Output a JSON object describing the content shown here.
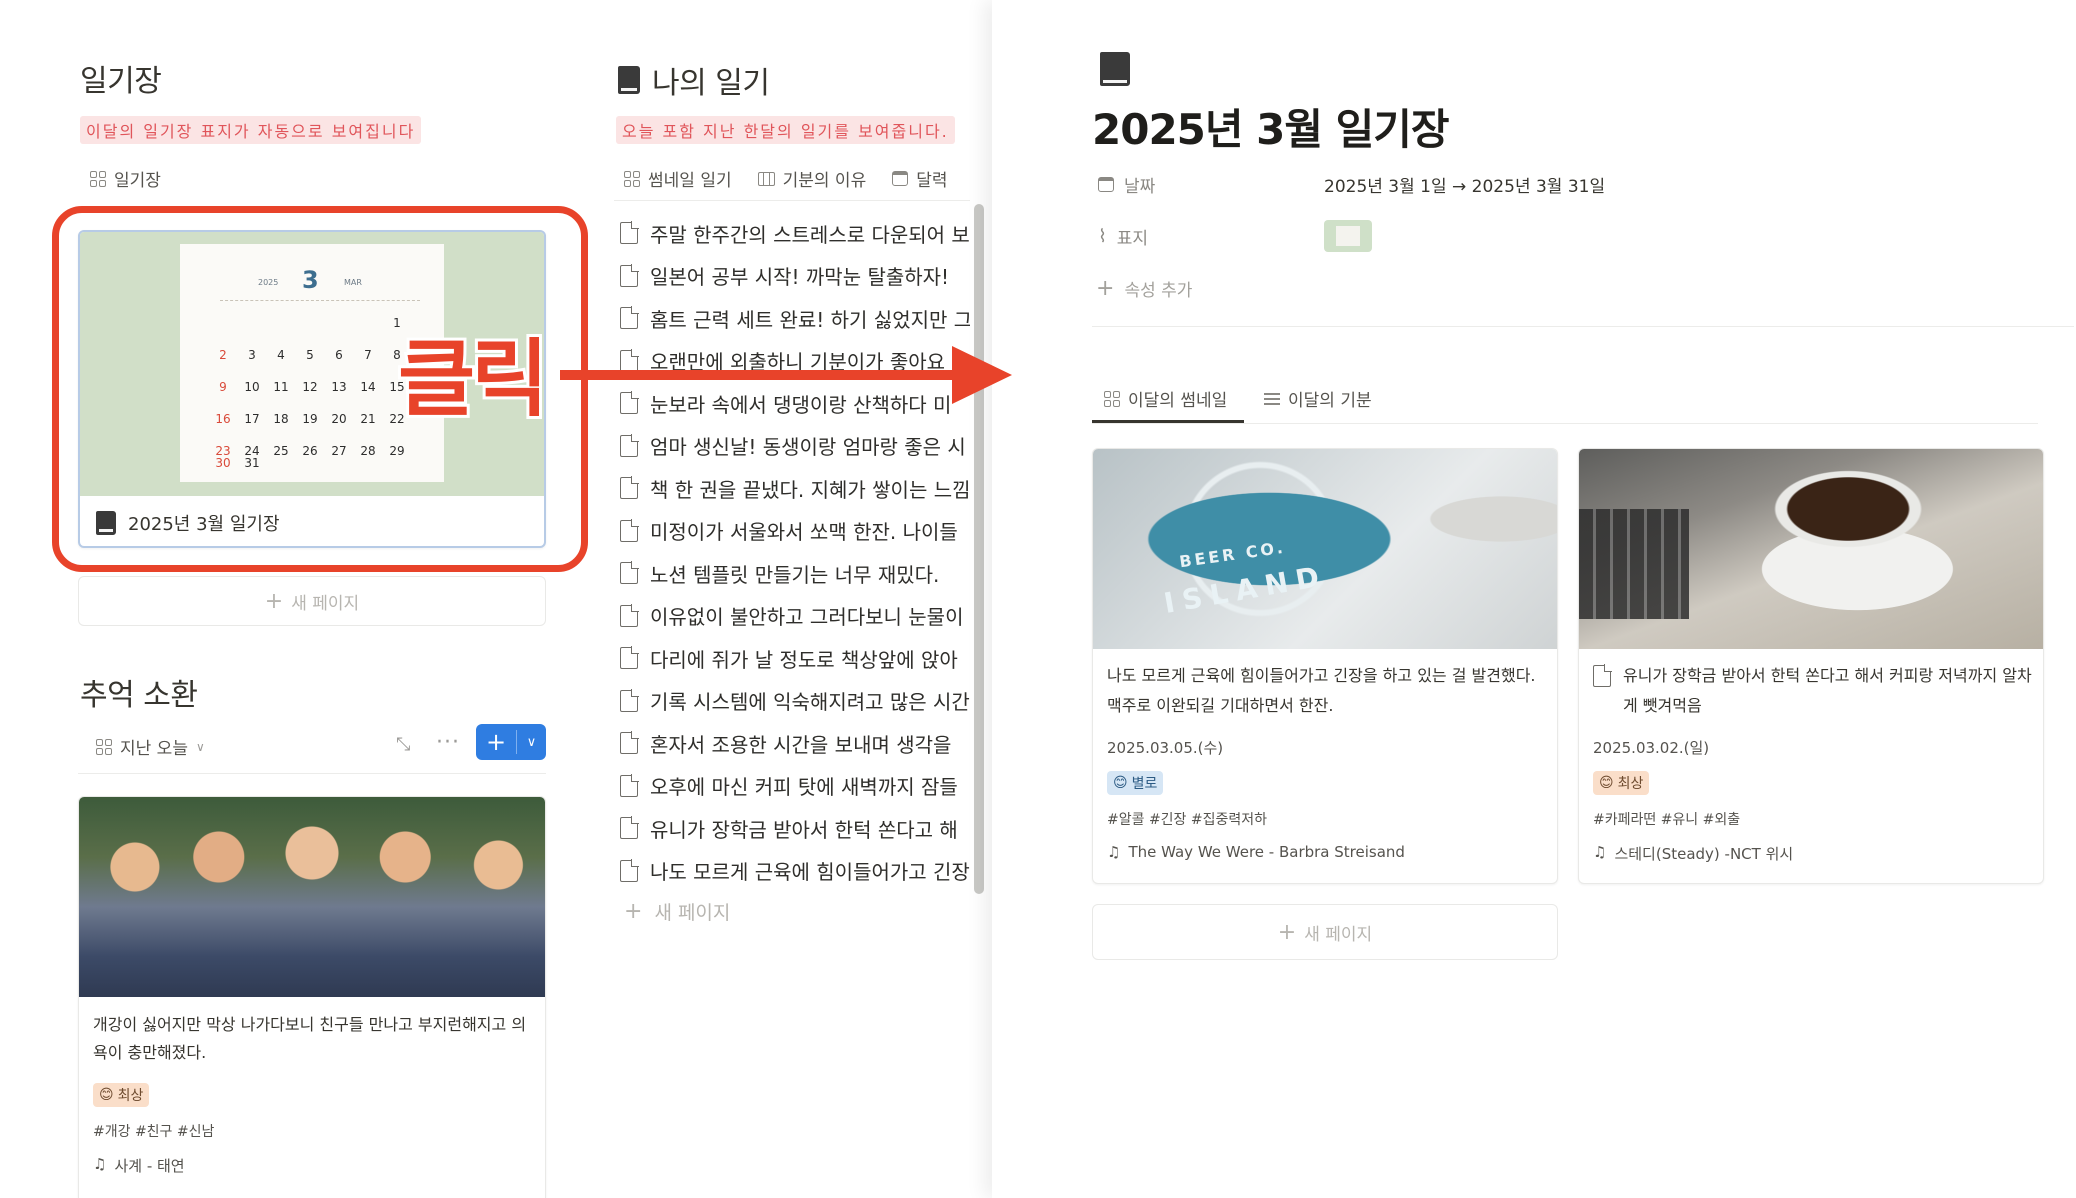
{
  "left": {
    "diary_title": "일기장",
    "diary_hint": "이달의 일기장 표지가 자동으로 보여집니다",
    "diary_view": "일기장",
    "calendar_card": {
      "year": "2025",
      "month": "3",
      "month_abbr": "MAR",
      "days": [
        "1",
        "2",
        "3",
        "4",
        "5",
        "6",
        "7",
        "8",
        "9",
        "10",
        "11",
        "12",
        "13",
        "14",
        "15",
        "16",
        "17",
        "18",
        "19",
        "20",
        "21",
        "22",
        "23",
        "24",
        "25",
        "26",
        "27",
        "28",
        "29",
        "30",
        "31"
      ],
      "caption": "2025년 3월 일기장"
    },
    "new_page": "새 페이지",
    "memory_title": "추억 소환",
    "memory_view": "지난 오늘",
    "memory_card": {
      "text": "개강이 싫어지만 막상 나가다보니 친구들 만나고 부지런해지고 의욕이 충만해졌다.",
      "mood_emoji": "😊",
      "mood": "최상",
      "tags": "#개강 #친구 #신남",
      "song": "사계 - 태연"
    }
  },
  "middle": {
    "title": "나의 일기",
    "hint": "오늘 포함 지난 한달의 일기를 보여줍니다.",
    "views": [
      "썸네일 일기",
      "기분의 이유",
      "달력"
    ],
    "entries": [
      "주말 한주간의 스트레스로 다운되어 보",
      "일본어 공부 시작! 까막눈 탈출하자!",
      "홈트 근력 세트 완료! 하기 싫었지만 그",
      "오랜만에 외출하니 기분이가 좋아요",
      "눈보라 속에서 댕댕이랑 산책하다 미",
      "엄마 생신날! 동생이랑 엄마랑 좋은 시",
      "책 한 권을 끝냈다. 지혜가 쌓이는 느낌",
      "미정이가 서울와서 쏘맥 한잔. 나이들",
      "노션 템플릿 만들기는 너무 재밌다.",
      "이유없이 불안하고 그러다보니 눈물이",
      "다리에 쥐가 날 정도로 책상앞에 앉아",
      "기록 시스템에 익숙해지려고 많은 시간",
      "혼자서 조용한 시간을 보내며 생각을",
      "오후에 마신 커피 탓에 새벽까지 잠들",
      "유니가 장학금 받아서 한턱 쏜다고 해",
      "나도 모르게 근육에 힘이들어가고 긴장"
    ],
    "new_page": "새 페이지"
  },
  "annotation": {
    "click": "클릭",
    "color": "#e8432a"
  },
  "right": {
    "title": "2025년 3월 일기장",
    "props": {
      "date_label": "날짜",
      "date_value": "2025년 3월 1일 → 2025년 3월 31일",
      "cover_label": "표지",
      "add_prop": "속성 추가"
    },
    "tabs": [
      "이달의 썸네일",
      "이달의 기분"
    ],
    "cards": [
      {
        "text": "나도 모르게 근육에 힘이들어가고 긴장을 하고 있는 걸 발견했다. 맥주로 이완되길 기대하면서 한잔.",
        "date": "2025.03.05.(수)",
        "mood_emoji": "😊",
        "mood": "별로",
        "tags": "#알콜 #긴장 #집중력저하",
        "song": "The Way We Were - Barbra Streisand"
      },
      {
        "text": "유니가 장학금 받아서 한턱 쏜다고 해서 커피랑 저녁까지 알차게 뺏겨먹음",
        "date": "2025.03.02.(일)",
        "mood_emoji": "😊",
        "mood": "최상",
        "tags": "#카페라떤 #유니 #외출",
        "song": "스테디(Steady) -NCT 위시"
      }
    ],
    "new_page": "새 페이지"
  }
}
